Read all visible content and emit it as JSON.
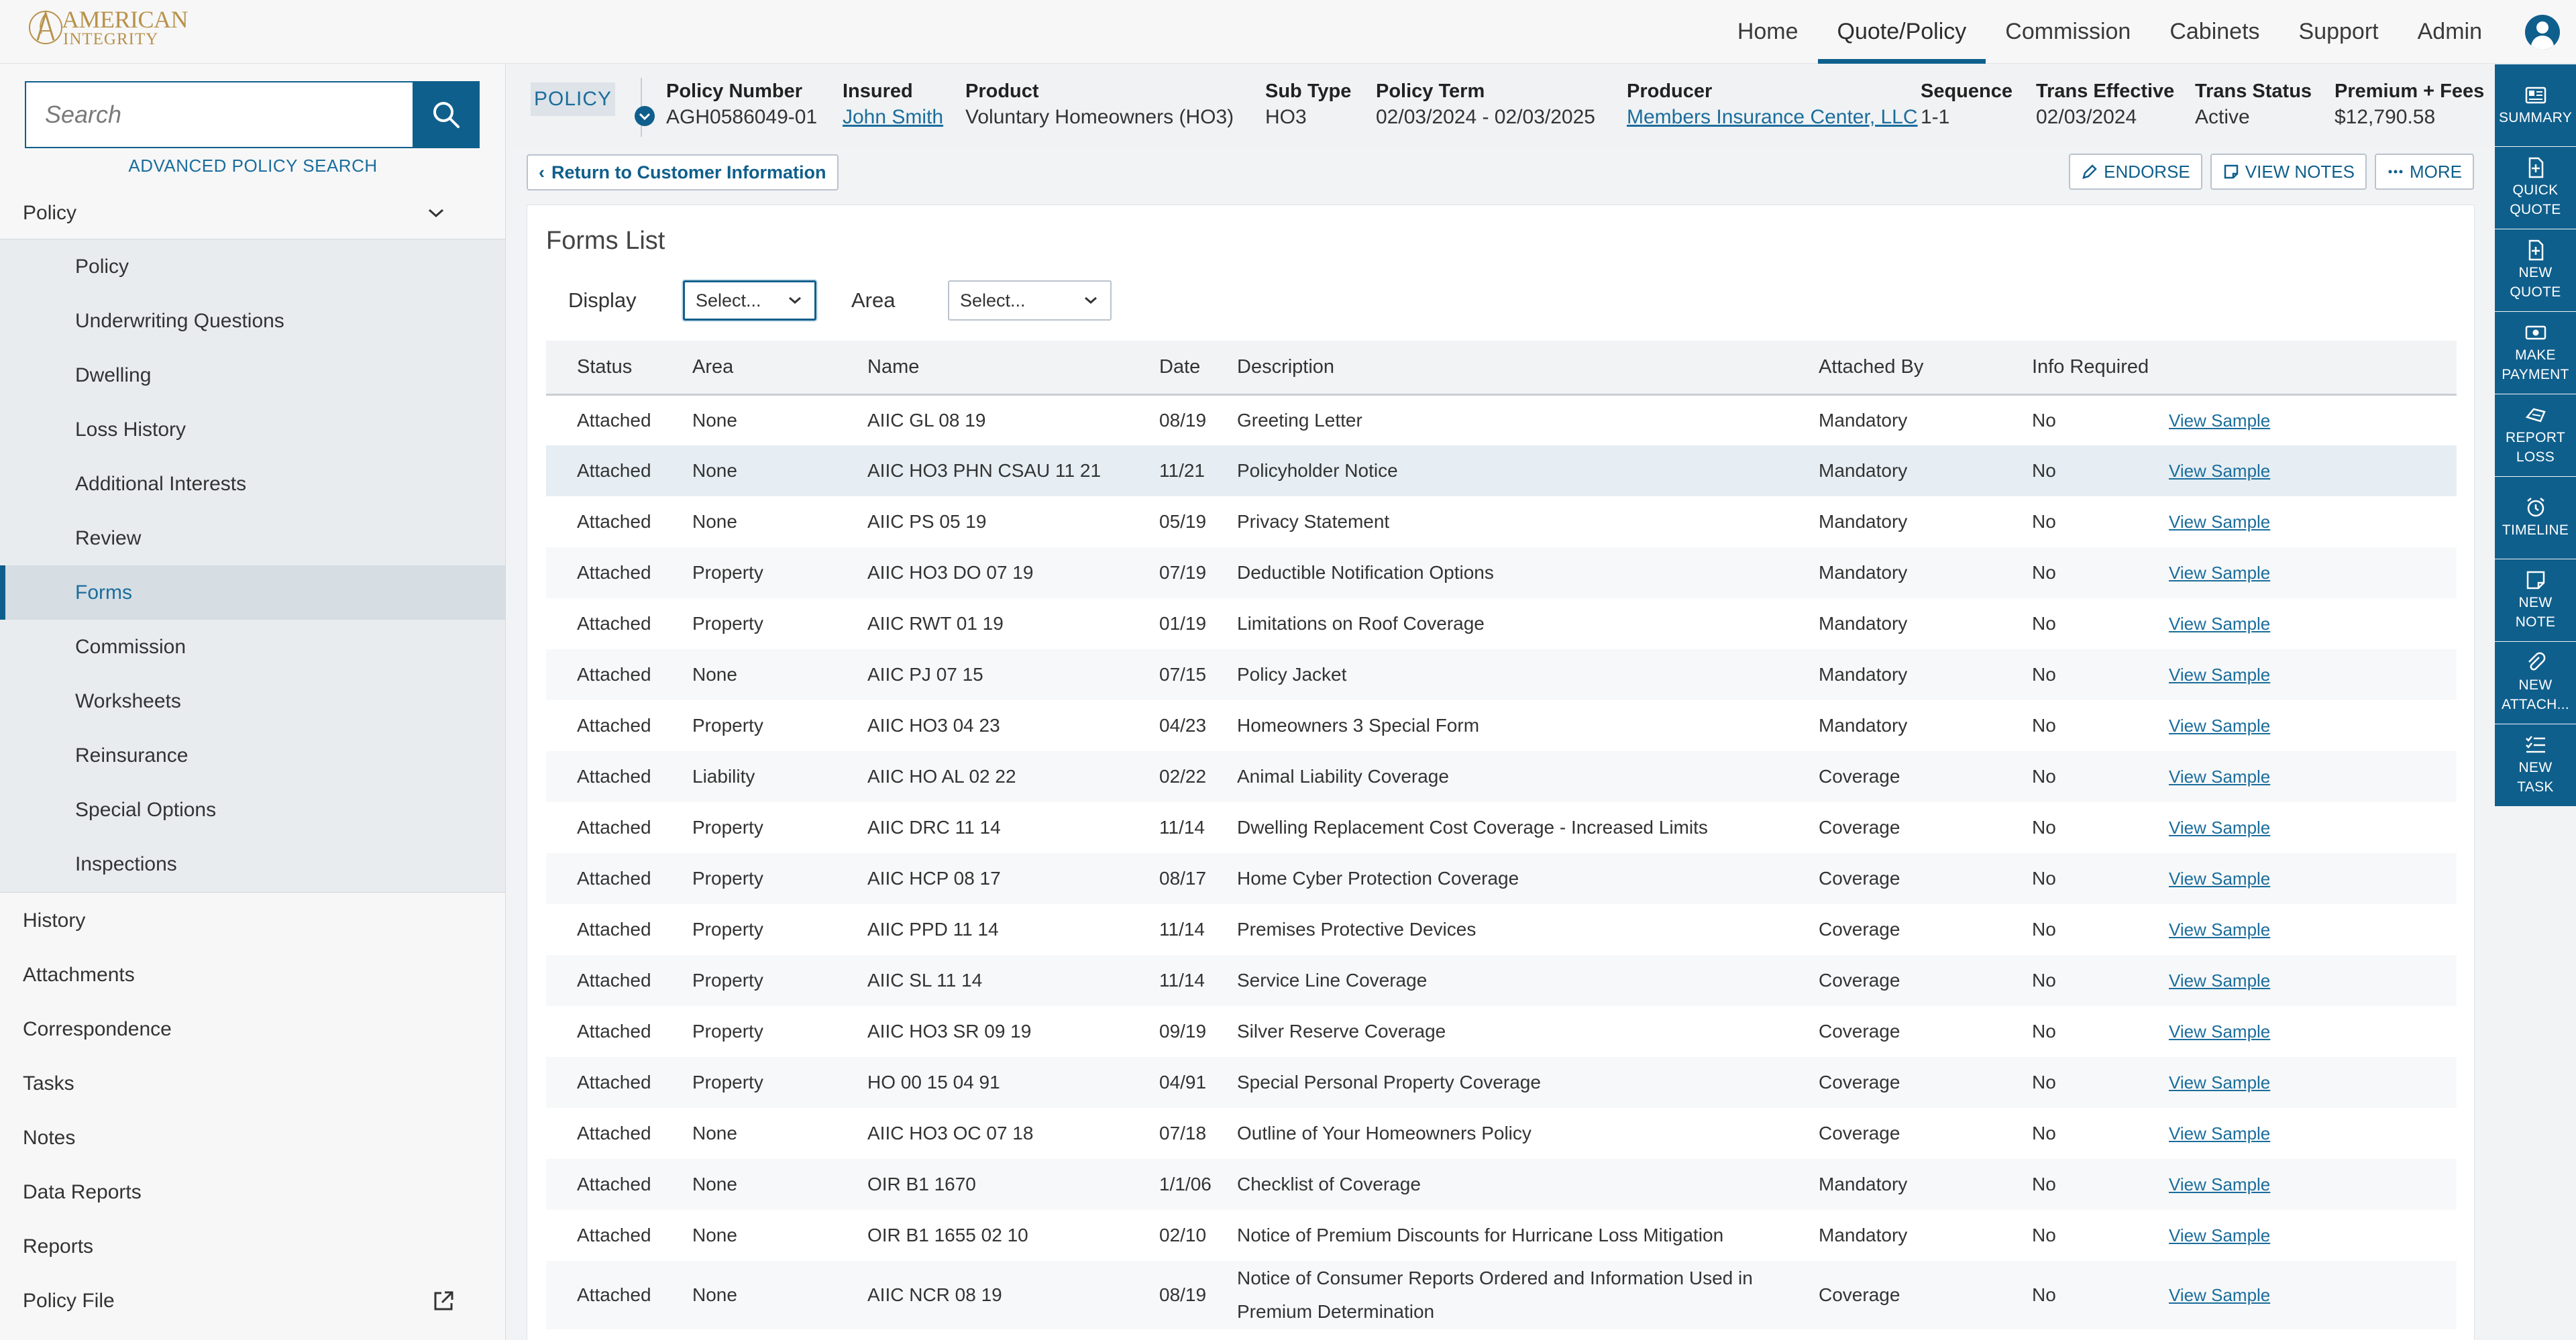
{
  "app": {
    "logo_text_line1": "AMERICAN",
    "logo_text_line2": "INTEGRITY",
    "brand_color": "#0f5f8c",
    "logo_color": "#b8924a"
  },
  "nav": {
    "items": [
      {
        "label": "Home"
      },
      {
        "label": "Quote/Policy",
        "active": true
      },
      {
        "label": "Commission"
      },
      {
        "label": "Cabinets"
      },
      {
        "label": "Support"
      },
      {
        "label": "Admin"
      }
    ],
    "user_icon": "user-avatar-icon"
  },
  "sidebar": {
    "search_placeholder": "Search",
    "search_icon": "search-icon",
    "advanced_search": "ADVANCED POLICY SEARCH",
    "policy_section": "Policy",
    "policy_items": [
      {
        "label": "Policy"
      },
      {
        "label": "Underwriting Questions"
      },
      {
        "label": "Dwelling"
      },
      {
        "label": "Loss History"
      },
      {
        "label": "Additional Interests"
      },
      {
        "label": "Review"
      },
      {
        "label": "Forms",
        "active": true
      },
      {
        "label": "Commission"
      },
      {
        "label": "Worksheets"
      },
      {
        "label": "Reinsurance"
      },
      {
        "label": "Special Options"
      },
      {
        "label": "Inspections"
      }
    ],
    "main_items": [
      {
        "label": "History"
      },
      {
        "label": "Attachments"
      },
      {
        "label": "Correspondence"
      },
      {
        "label": "Tasks"
      },
      {
        "label": "Notes"
      },
      {
        "label": "Data Reports"
      },
      {
        "label": "Reports"
      },
      {
        "label": "Policy File",
        "icon": "external-link-icon"
      }
    ]
  },
  "rail": {
    "buttons": [
      {
        "line1": "SUMMARY",
        "line2": "",
        "icon": "summary-icon"
      },
      {
        "line1": "QUICK",
        "line2": "QUOTE",
        "icon": "quick-quote-icon"
      },
      {
        "line1": "NEW",
        "line2": "QUOTE",
        "icon": "new-quote-icon"
      },
      {
        "line1": "MAKE",
        "line2": "PAYMENT",
        "icon": "payment-icon"
      },
      {
        "line1": "REPORT",
        "line2": "LOSS",
        "icon": "report-loss-icon"
      },
      {
        "line1": "TIMELINE",
        "line2": "",
        "icon": "alarm-clock-icon"
      },
      {
        "line1": "NEW",
        "line2": "NOTE",
        "icon": "note-icon"
      },
      {
        "line1": "NEW",
        "line2": "ATTACH...",
        "icon": "paperclip-icon"
      },
      {
        "line1": "NEW",
        "line2": "TASK",
        "icon": "task-list-icon"
      }
    ]
  },
  "policy_header": {
    "badge": "POLICY",
    "fields": {
      "policy_number": {
        "label": "Policy Number",
        "value": "AGH0586049-01"
      },
      "insured": {
        "label": "Insured",
        "value": "John Smith"
      },
      "product": {
        "label": "Product",
        "value": "Voluntary Homeowners (HO3)"
      },
      "sub_type": {
        "label": "Sub Type",
        "value": "HO3"
      },
      "policy_term": {
        "label": "Policy Term",
        "value": "02/03/2024 - 02/03/2025"
      },
      "producer": {
        "label": "Producer",
        "value": "Members Insurance Center, LLC"
      },
      "sequence": {
        "label": "Sequence",
        "value": "1-1"
      },
      "trans_effective": {
        "label": "Trans Effective",
        "value": "02/03/2024"
      },
      "trans_status": {
        "label": "Trans Status",
        "value": "Active"
      },
      "premium": {
        "label": "Premium + Fees",
        "value": "$12,790.58"
      }
    }
  },
  "toolbar": {
    "return_label": "Return to Customer Information",
    "endorse_label": "ENDORSE",
    "view_notes_label": "VIEW NOTES",
    "more_label": "MORE"
  },
  "forms": {
    "title": "Forms List",
    "display_label": "Display",
    "display_value": "Select...",
    "area_label": "Area",
    "area_value": "Select...",
    "columns": [
      "Status",
      "Area",
      "Name",
      "Date",
      "Description",
      "Attached By",
      "Info Required",
      ""
    ],
    "rows": [
      {
        "status": "Attached",
        "area": "None",
        "name": "AIIC GL 08 19",
        "date": "08/19",
        "description": "Greeting Letter",
        "attached_by": "Mandatory",
        "info": "No",
        "link": "View Sample"
      },
      {
        "status": "Attached",
        "area": "None",
        "name": "AIIC HO3 PHN CSAU 11 21",
        "date": "11/21",
        "description": "Policyholder Notice",
        "attached_by": "Mandatory",
        "info": "No",
        "link": "View Sample"
      },
      {
        "status": "Attached",
        "area": "None",
        "name": "AIIC PS 05 19",
        "date": "05/19",
        "description": "Privacy Statement",
        "attached_by": "Mandatory",
        "info": "No",
        "link": "View Sample"
      },
      {
        "status": "Attached",
        "area": "Property",
        "name": "AIIC HO3 DO 07 19",
        "date": "07/19",
        "description": "Deductible Notification Options",
        "attached_by": "Mandatory",
        "info": "No",
        "link": "View Sample"
      },
      {
        "status": "Attached",
        "area": "Property",
        "name": "AIIC RWT 01 19",
        "date": "01/19",
        "description": "Limitations on Roof Coverage",
        "attached_by": "Mandatory",
        "info": "No",
        "link": "View Sample"
      },
      {
        "status": "Attached",
        "area": "None",
        "name": "AIIC PJ 07 15",
        "date": "07/15",
        "description": "Policy Jacket",
        "attached_by": "Mandatory",
        "info": "No",
        "link": "View Sample"
      },
      {
        "status": "Attached",
        "area": "Property",
        "name": "AIIC HO3 04 23",
        "date": "04/23",
        "description": "Homeowners 3 Special Form",
        "attached_by": "Mandatory",
        "info": "No",
        "link": "View Sample"
      },
      {
        "status": "Attached",
        "area": "Liability",
        "name": "AIIC HO AL 02 22",
        "date": "02/22",
        "description": "Animal Liability Coverage",
        "attached_by": "Coverage",
        "info": "No",
        "link": "View Sample"
      },
      {
        "status": "Attached",
        "area": "Property",
        "name": "AIIC DRC 11 14",
        "date": "11/14",
        "description": "Dwelling Replacement Cost Coverage - Increased Limits",
        "attached_by": "Coverage",
        "info": "No",
        "link": "View Sample"
      },
      {
        "status": "Attached",
        "area": "Property",
        "name": "AIIC HCP 08 17",
        "date": "08/17",
        "description": "Home Cyber Protection Coverage",
        "attached_by": "Coverage",
        "info": "No",
        "link": "View Sample"
      },
      {
        "status": "Attached",
        "area": "Property",
        "name": "AIIC PPD 11 14",
        "date": "11/14",
        "description": "Premises Protective Devices",
        "attached_by": "Coverage",
        "info": "No",
        "link": "View Sample"
      },
      {
        "status": "Attached",
        "area": "Property",
        "name": "AIIC SL 11 14",
        "date": "11/14",
        "description": "Service Line Coverage",
        "attached_by": "Coverage",
        "info": "No",
        "link": "View Sample"
      },
      {
        "status": "Attached",
        "area": "Property",
        "name": "AIIC HO3 SR 09 19",
        "date": "09/19",
        "description": "Silver Reserve Coverage",
        "attached_by": "Coverage",
        "info": "No",
        "link": "View Sample"
      },
      {
        "status": "Attached",
        "area": "Property",
        "name": "HO 00 15 04 91",
        "date": "04/91",
        "description": "Special Personal Property Coverage",
        "attached_by": "Coverage",
        "info": "No",
        "link": "View Sample"
      },
      {
        "status": "Attached",
        "area": "None",
        "name": "AIIC HO3 OC 07 18",
        "date": "07/18",
        "description": "Outline of Your Homeowners Policy",
        "attached_by": "Coverage",
        "info": "No",
        "link": "View Sample"
      },
      {
        "status": "Attached",
        "area": "None",
        "name": "OIR B1 1670",
        "date": "1/1/06",
        "description": "Checklist of Coverage",
        "attached_by": "Mandatory",
        "info": "No",
        "link": "View Sample"
      },
      {
        "status": "Attached",
        "area": "None",
        "name": "OIR B1 1655 02 10",
        "date": "02/10",
        "description": "Notice of Premium Discounts for Hurricane Loss Mitigation",
        "attached_by": "Mandatory",
        "info": "No",
        "link": "View Sample"
      },
      {
        "status": "Attached",
        "area": "None",
        "name": "AIIC NCR 08 19",
        "date": "08/19",
        "description": "Notice of Consumer Reports Ordered and Information Used in Premium Determination",
        "attached_by": "Coverage",
        "info": "No",
        "link": "View Sample"
      }
    ]
  }
}
